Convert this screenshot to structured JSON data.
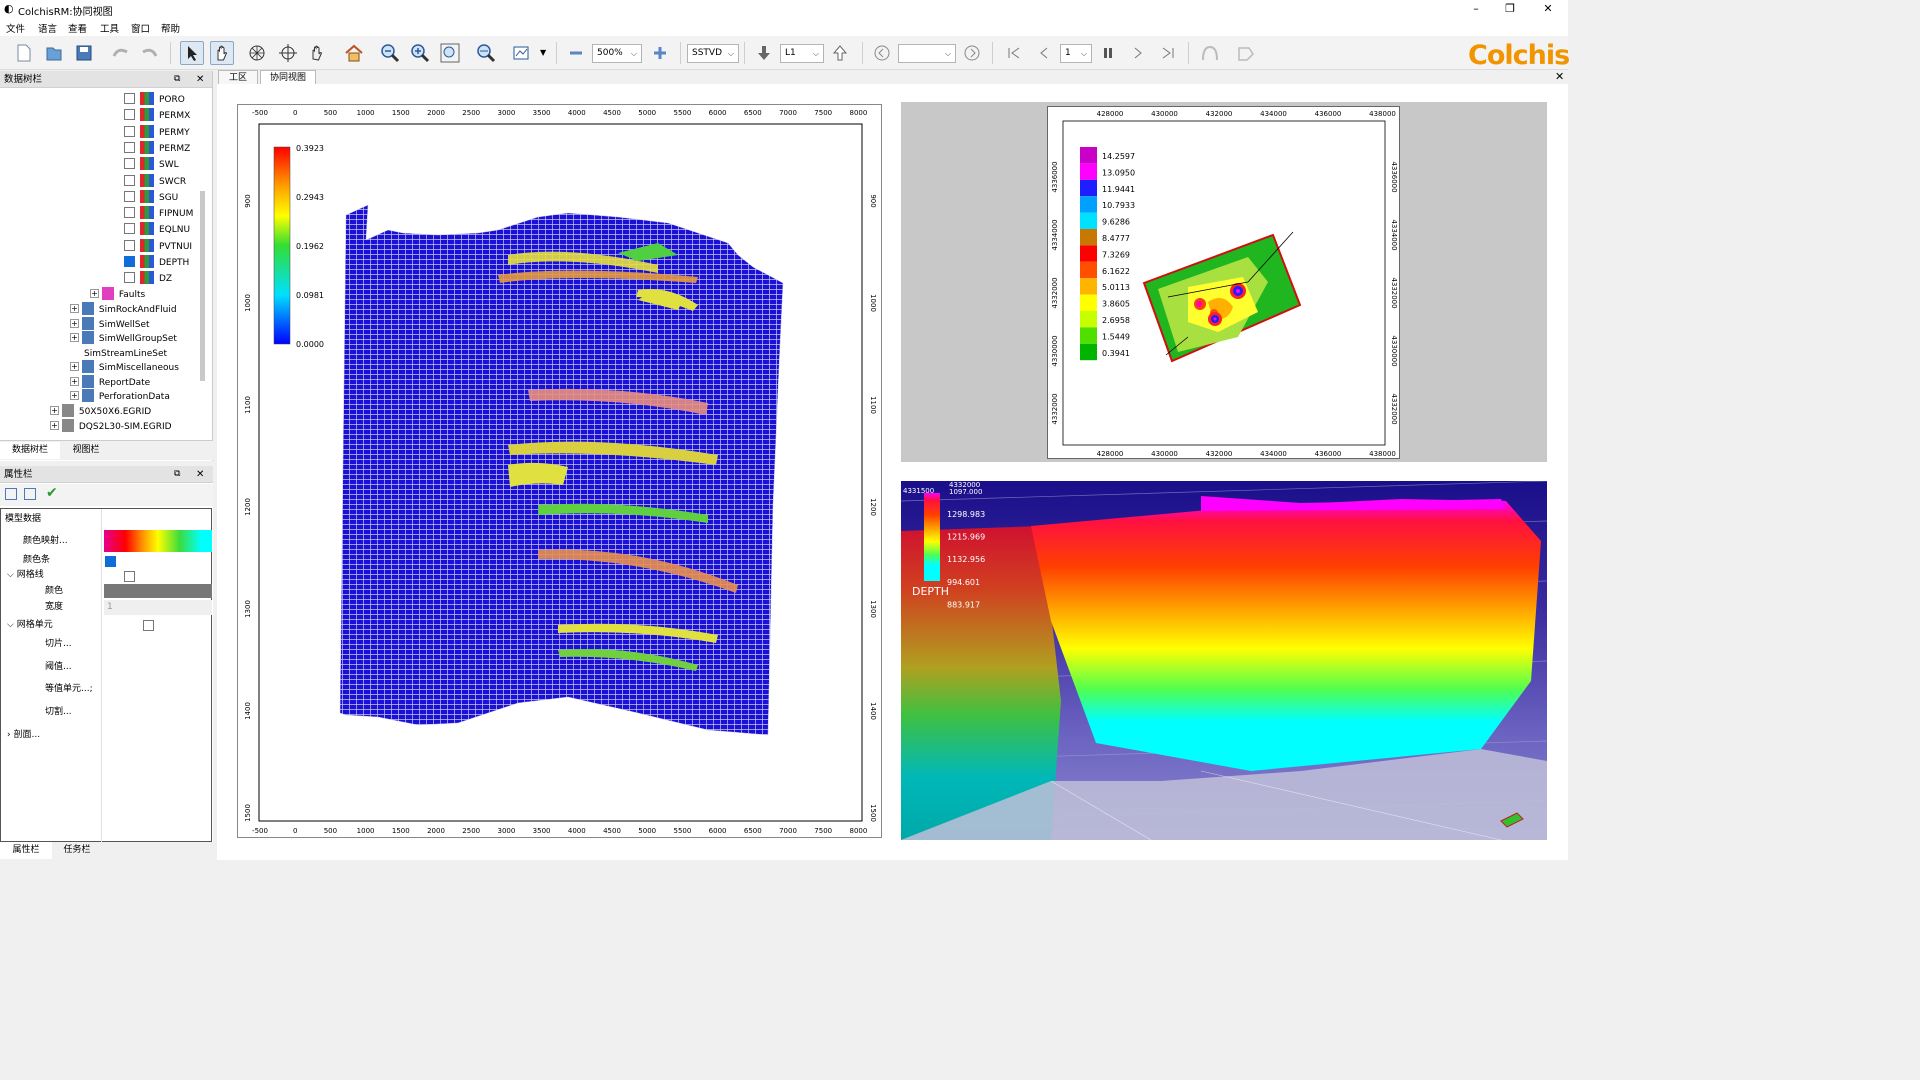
{
  "window": {
    "title": "ColchisRM:协同视图",
    "min": "–",
    "max": "❐",
    "close": "✕"
  },
  "menu": [
    "文件",
    "语言",
    "查看",
    "工具",
    "窗口",
    "帮助"
  ],
  "toolbar": {
    "zoom": "500%",
    "depth_mode": "SSTVD",
    "layer": "L1",
    "step": "1",
    "page": ""
  },
  "logo": "Colchis",
  "tree_panel": {
    "title": "数据树栏",
    "items": [
      {
        "label": "PORO",
        "checked": false
      },
      {
        "label": "PERMX",
        "checked": false
      },
      {
        "label": "PERMY",
        "checked": false
      },
      {
        "label": "PERMZ",
        "checked": false
      },
      {
        "label": "SWL",
        "checked": false
      },
      {
        "label": "SWCR",
        "checked": false
      },
      {
        "label": "SGU",
        "checked": false
      },
      {
        "label": "FIPNUM",
        "checked": false
      },
      {
        "label": "EQLNU",
        "checked": false
      },
      {
        "label": "PVTNUI",
        "checked": false
      },
      {
        "label": "DEPTH",
        "checked": true
      },
      {
        "label": "DZ",
        "checked": false
      }
    ],
    "groups": [
      "Faults",
      "SimRockAndFluid",
      "SimWellSet",
      "SimWellGroupSet",
      "SimStreamLineSet",
      "SimMiscellaneous",
      "ReportDate",
      "PerforationData",
      "50X50X6.EGRID",
      "DQS2L30-SIM.EGRID"
    ],
    "tabs": [
      "数据树栏",
      "视图栏"
    ]
  },
  "prop_panel": {
    "title": "属性栏",
    "section": "模型数据",
    "rows": {
      "colormap": "颜色映射...",
      "colorbar": "颜色条",
      "gridline": "网格线",
      "color": "颜色",
      "width": "宽度",
      "width_val": "1",
      "cell": "网格单元",
      "slice": "切片...",
      "threshold": "阈值...",
      "iso": "等值单元...;",
      "cut": "切割...",
      "profile": "剖面..."
    },
    "tabs": [
      "属性栏",
      "任务栏"
    ]
  },
  "view_tabs": [
    "工区",
    "协同视图"
  ],
  "section_view": {
    "x_ticks": [
      "-500",
      "0",
      "500",
      "1000",
      "1500",
      "2000",
      "2500",
      "3000",
      "3500",
      "4000",
      "4500",
      "5000",
      "5500",
      "6000",
      "6500",
      "7000",
      "7500",
      "8000"
    ],
    "y_ticks": [
      "900",
      "1000",
      "1100",
      "1200",
      "1300",
      "1400",
      "1500"
    ],
    "legend": [
      "0.3923",
      "0.2943",
      "0.1962",
      "0.0981",
      "0.0000"
    ]
  },
  "map_view": {
    "x_ticks": [
      "428000",
      "430000",
      "432000",
      "434000",
      "436000",
      "438000"
    ],
    "y_ticks_left": [
      "4336000",
      "4334000",
      "4332000",
      "4330000",
      "4332000"
    ],
    "y_ticks_right": [
      "4336000",
      "4334000",
      "4332000",
      "4330000",
      "4332000"
    ],
    "legend": [
      "14.2597",
      "13.0950",
      "11.9441",
      "10.7933",
      "9.6286",
      "8.4777",
      "7.3269",
      "6.1622",
      "5.0113",
      "3.8605",
      "2.6958",
      "1.5449",
      "0.3941"
    ],
    "legend_colors": [
      "#c800c8",
      "#ff00ff",
      "#1e1eff",
      "#00a0ff",
      "#00e0ff",
      "#c87800",
      "#ff0000",
      "#ff5000",
      "#ffb400",
      "#ffff00",
      "#c8ff00",
      "#50e000",
      "#00b400"
    ]
  },
  "view3d": {
    "legend": [
      "1298.983",
      "1215.969",
      "1132.956",
      "994.601",
      "883.917"
    ],
    "legend_top": [
      "4332000",
      "1097.000"
    ],
    "legend_left": "4331500",
    "title": "DEPTH"
  }
}
